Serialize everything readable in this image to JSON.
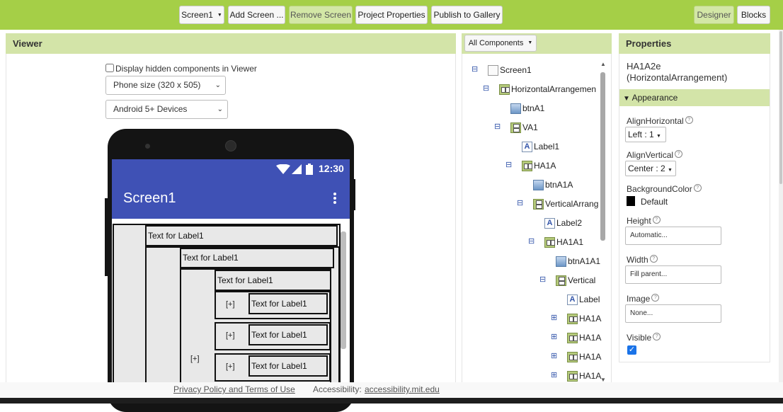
{
  "toolbar": {
    "screen_select": "Screen1",
    "add_screen": "Add Screen ...",
    "remove_screen": "Remove Screen",
    "project_properties": "Project Properties",
    "publish_gallery": "Publish to Gallery",
    "designer": "Designer",
    "blocks": "Blocks"
  },
  "viewer": {
    "title": "Viewer",
    "hidden_checkbox_label": "Display hidden components in Viewer",
    "phone_size": "Phone size (320 x 505)",
    "device_type": "Android 5+ Devices",
    "phone": {
      "time": "12:30",
      "app_title": "Screen1",
      "label_text": "Text for Label1",
      "plus_text": "[+]"
    }
  },
  "components": {
    "selector": "All Components",
    "tree": [
      {
        "name": "Screen1",
        "icon": "screen-icon",
        "toggle": "minus"
      },
      {
        "name": "HorizontalArrangemen",
        "icon": "horizontal-arrangement-icon",
        "toggle": "minus"
      },
      {
        "name": "btnA1",
        "icon": "button-icon",
        "toggle": ""
      },
      {
        "name": "VA1",
        "icon": "vertical-arrangement-icon",
        "toggle": "minus"
      },
      {
        "name": "Label1",
        "icon": "label-icon",
        "toggle": ""
      },
      {
        "name": "HA1A",
        "icon": "horizontal-arrangement-icon",
        "toggle": "minus"
      },
      {
        "name": "btnA1A",
        "icon": "button-icon",
        "toggle": ""
      },
      {
        "name": "VerticalArrang",
        "icon": "vertical-arrangement-icon",
        "toggle": "minus"
      },
      {
        "name": "Label2",
        "icon": "label-icon",
        "toggle": ""
      },
      {
        "name": "HA1A1",
        "icon": "horizontal-arrangement-icon",
        "toggle": "minus"
      },
      {
        "name": "btnA1A1",
        "icon": "button-icon",
        "toggle": ""
      },
      {
        "name": "Vertical",
        "icon": "vertical-arrangement-icon",
        "toggle": "minus"
      },
      {
        "name": "Label",
        "icon": "label-icon",
        "toggle": ""
      },
      {
        "name": "HA1A",
        "icon": "horizontal-arrangement-icon",
        "toggle": "plus"
      },
      {
        "name": "HA1A",
        "icon": "horizontal-arrangement-icon",
        "toggle": "plus"
      },
      {
        "name": "HA1A",
        "icon": "horizontal-arrangement-icon",
        "toggle": "plus"
      },
      {
        "name": "HA1A",
        "icon": "horizontal-arrangement-icon",
        "toggle": "plus"
      }
    ]
  },
  "properties": {
    "title": "Properties",
    "component_name": "HA1A2e",
    "component_type": "(HorizontalArrangement)",
    "section": "Appearance",
    "align_horizontal_label": "AlignHorizontal",
    "align_horizontal_value": "Left : 1",
    "align_vertical_label": "AlignVertical",
    "align_vertical_value": "Center : 2",
    "background_color_label": "BackgroundColor",
    "background_color_value": "Default",
    "background_color_swatch": "#000000",
    "height_label": "Height",
    "height_value": "Automatic...",
    "width_label": "Width",
    "width_value": "Fill parent...",
    "image_label": "Image",
    "image_value": "None...",
    "visible_label": "Visible",
    "help_symbol": "?"
  },
  "footer": {
    "privacy": "Privacy Policy and Terms of Use",
    "accessibility_prefix": "Accessibility:",
    "accessibility_link": "accessibility.mit.edu"
  },
  "colors": {
    "toolbar": "#a5cf47",
    "panel_header": "#d3e4a8",
    "android_primary": "#3f51b5"
  }
}
